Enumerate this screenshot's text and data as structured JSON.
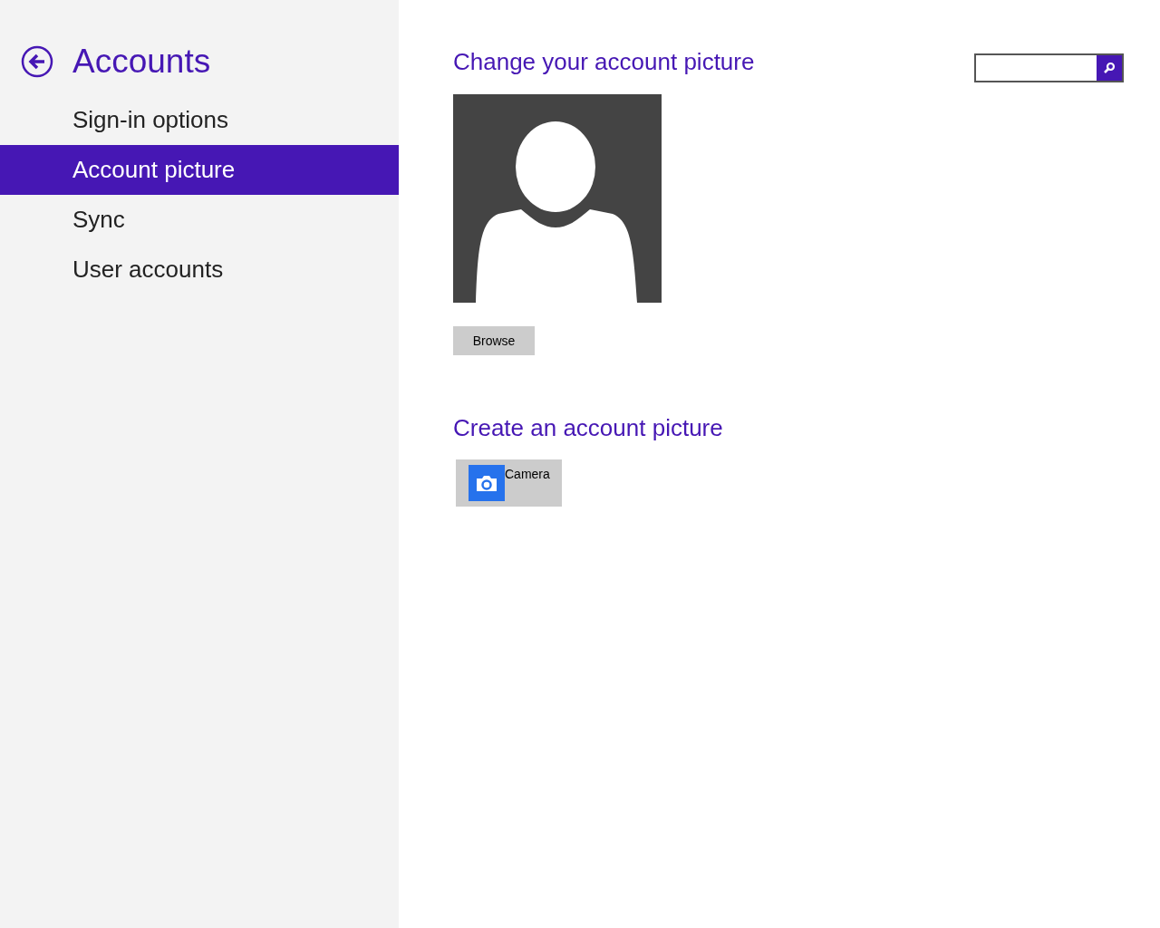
{
  "sidebar": {
    "title": "Accounts",
    "items": [
      {
        "label": "Sign-in options",
        "selected": false
      },
      {
        "label": "Account picture",
        "selected": true
      },
      {
        "label": "Sync",
        "selected": false
      },
      {
        "label": "User accounts",
        "selected": false
      }
    ]
  },
  "change_section": {
    "heading": "Change your account picture",
    "button": "Browse"
  },
  "create_section": {
    "heading": "Create an account picture",
    "apps": [
      {
        "label": "Camera"
      }
    ]
  }
}
